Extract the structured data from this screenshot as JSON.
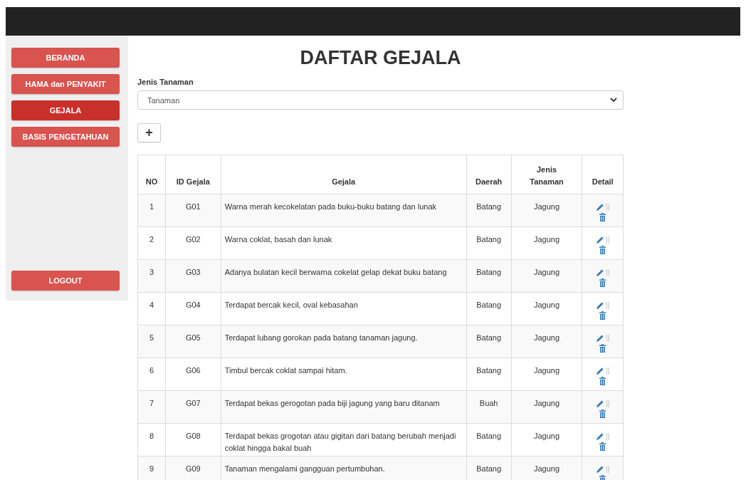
{
  "nav": {
    "items": [
      {
        "label": "BERANDA",
        "selected": false
      },
      {
        "label": "HAMA dan PENYAKIT",
        "selected": false
      },
      {
        "label": "GEJALA",
        "selected": true
      },
      {
        "label": "BASIS PENGETAHUAN",
        "selected": false
      }
    ],
    "logout": "LOGOUT"
  },
  "page": {
    "title": "DAFTAR GEJALA",
    "filter_label": "Jenis Tanaman",
    "filter_value": "Tanaman",
    "add_button": "+"
  },
  "table": {
    "columns": [
      "NO",
      "ID Gejala",
      "Gejala",
      "Daerah",
      "Jenis Tanaman",
      "Detail"
    ],
    "rows": [
      {
        "no": "1",
        "id": "G01",
        "gejala": "Warna merah kecokelatan pada buku-buku batang dan lunak",
        "daerah": "Batang",
        "jenis": "Jagung",
        "separator": "||"
      },
      {
        "no": "2",
        "id": "G02",
        "gejala": "Warna coklat, basah dan lunak",
        "daerah": "Batang",
        "jenis": "Jagung",
        "separator": "||"
      },
      {
        "no": "3",
        "id": "G03",
        "gejala": "Adanya bulatan kecil berwarna cokelat gelap dekat buku batang",
        "daerah": "Batang",
        "jenis": "Jagung",
        "separator": "||"
      },
      {
        "no": "4",
        "id": "G04",
        "gejala": "Terdapat bercak kecil, oval kebasahan",
        "daerah": "Batang",
        "jenis": "Jagung",
        "separator": "||"
      },
      {
        "no": "5",
        "id": "G05",
        "gejala": "Terdapat lubang gorokan pada batang tanaman jagung.",
        "daerah": "Batang",
        "jenis": "Jagung",
        "separator": "||"
      },
      {
        "no": "6",
        "id": "G06",
        "gejala": "Timbul bercak coklat sampai hitam.",
        "daerah": "Batang",
        "jenis": "Jagung",
        "separator": "||"
      },
      {
        "no": "7",
        "id": "G07",
        "gejala": "Terdapat bekas gerogotan pada biji jagung yang baru ditanam",
        "daerah": "Buah",
        "jenis": "Jagung",
        "separator": "||"
      },
      {
        "no": "8",
        "id": "G08",
        "gejala": "Terdapat bekas grogotan atau gigitan dari batang berubah menjadi coklat hingga bakal buah",
        "daerah": "Batang",
        "jenis": "Jagung",
        "separator": "||"
      },
      {
        "no": "9",
        "id": "G09",
        "gejala": "Tanaman mengalami gangguan pertumbuhan.",
        "daerah": "Batang",
        "jenis": "Jagung",
        "separator": "||"
      }
    ]
  }
}
